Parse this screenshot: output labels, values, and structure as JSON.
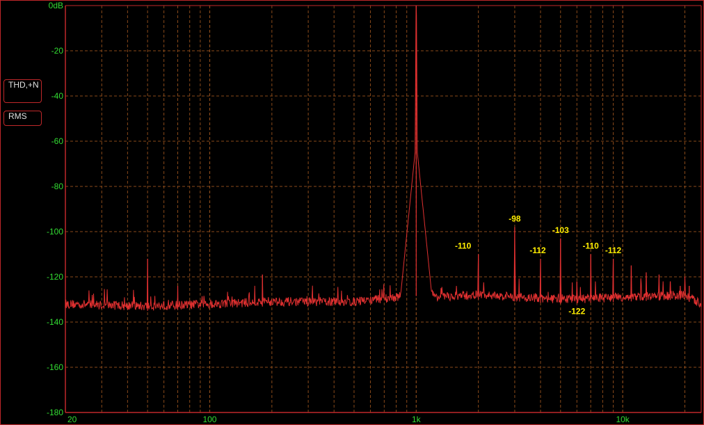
{
  "buttons": {
    "thd_label": "THD,+N",
    "rms_label": "RMS"
  },
  "colors": {
    "trace": "#e03030",
    "grid": "#8a4a1a",
    "axis_text": "#33dd33",
    "annotation_text": "#ffee00",
    "frame": "#c0282a"
  },
  "chart_data": {
    "type": "line",
    "x_scale": "log",
    "xlim": [
      20,
      24000
    ],
    "ylim": [
      -180,
      0
    ],
    "grid": true,
    "y_ticks": [
      {
        "value": 0,
        "label": "0dB"
      },
      {
        "value": -20,
        "label": "-20"
      },
      {
        "value": -40,
        "label": "-40"
      },
      {
        "value": -60,
        "label": "-60"
      },
      {
        "value": -80,
        "label": "-80"
      },
      {
        "value": -100,
        "label": "-100"
      },
      {
        "value": -120,
        "label": "-120"
      },
      {
        "value": -140,
        "label": "-140"
      },
      {
        "value": -160,
        "label": "-160"
      },
      {
        "value": -180,
        "label": "-180"
      }
    ],
    "x_ticks": [
      {
        "value": 20,
        "label": "20"
      },
      {
        "value": 100,
        "label": "100"
      },
      {
        "value": 1000,
        "label": "1k"
      },
      {
        "value": 10000,
        "label": "10k"
      }
    ],
    "noise_floor": [
      [
        20,
        -132
      ],
      [
        50,
        -133
      ],
      [
        100,
        -132
      ],
      [
        200,
        -131
      ],
      [
        500,
        -131
      ],
      [
        800,
        -129
      ],
      [
        950,
        -127
      ],
      [
        1050,
        -126
      ],
      [
        1300,
        -129
      ],
      [
        2000,
        -128
      ],
      [
        5000,
        -130
      ],
      [
        10000,
        -129
      ],
      [
        20000,
        -128
      ],
      [
        24000,
        -132
      ]
    ],
    "peaks": [
      {
        "freq": 1000,
        "level": 0
      },
      {
        "freq": 50,
        "level": -112
      },
      {
        "freq": 70,
        "level": -124
      },
      {
        "freq": 180,
        "level": -119
      },
      {
        "freq": 2000,
        "level": -110
      },
      {
        "freq": 3000,
        "level": -98
      },
      {
        "freq": 4000,
        "level": -112
      },
      {
        "freq": 5000,
        "level": -103
      },
      {
        "freq": 6000,
        "level": -122
      },
      {
        "freq": 7000,
        "level": -110
      },
      {
        "freq": 9000,
        "level": -112
      },
      {
        "freq": 11000,
        "level": -115
      },
      {
        "freq": 13000,
        "level": -118
      },
      {
        "freq": 15000,
        "level": -119
      },
      {
        "freq": 17000,
        "level": -122
      },
      {
        "freq": 19000,
        "level": -124
      },
      {
        "freq": 21000,
        "level": -124
      }
    ],
    "annotations": [
      {
        "label": "-110",
        "freq": 2000,
        "level": -110
      },
      {
        "label": "-98",
        "freq": 3000,
        "level": -98
      },
      {
        "label": "-112",
        "freq": 4000,
        "level": -112
      },
      {
        "label": "-103",
        "freq": 5000,
        "level": -103
      },
      {
        "label": "-122",
        "freq": 6000,
        "level": -122
      },
      {
        "label": "-110",
        "freq": 7000,
        "level": -110
      },
      {
        "label": "-112",
        "freq": 9000,
        "level": -112
      }
    ]
  }
}
